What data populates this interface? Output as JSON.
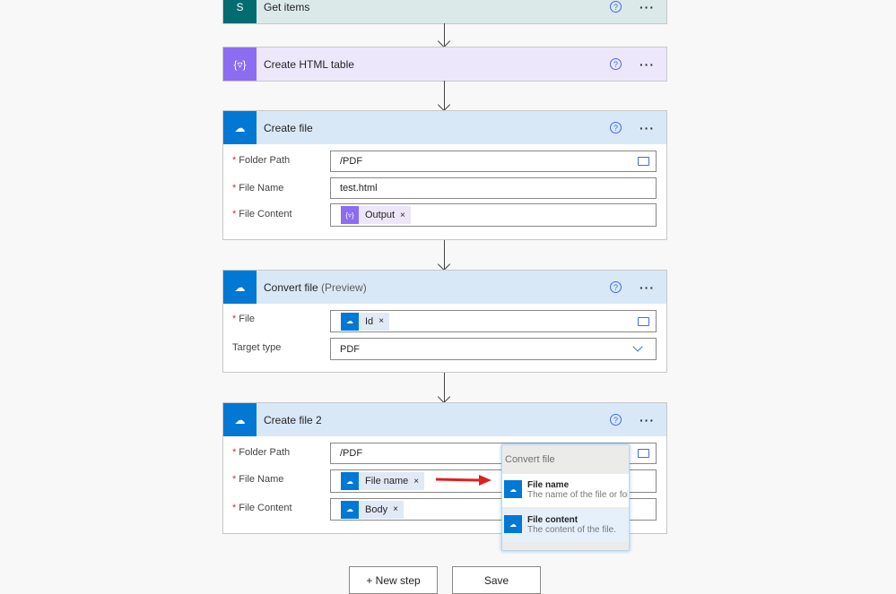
{
  "steps": [
    {
      "title": "Get items",
      "icon": "sharepoint-icon",
      "color": "#036c70",
      "header_bg": "#dbe9e9"
    },
    {
      "title": "Create HTML table",
      "icon": "data-operation-icon",
      "color": "#8c6cf0",
      "header_bg": "#ede7fc"
    },
    {
      "title": "Create file",
      "icon": "onedrive-icon",
      "color": "#0078d4",
      "header_bg": "#d9e8f6",
      "fields": [
        {
          "label": "Folder Path",
          "value": "/PDF"
        },
        {
          "label": "File Name",
          "value": "test.html"
        },
        {
          "label": "File Content",
          "token": "Output"
        }
      ]
    },
    {
      "title": "Convert file",
      "title_suffix": "(Preview)",
      "icon": "onedrive-icon",
      "color": "#0078d4",
      "header_bg": "#d9e8f6",
      "fields": [
        {
          "label": "File",
          "token": "Id"
        },
        {
          "label": "Target type",
          "value": "PDF"
        }
      ]
    },
    {
      "title": "Create file 2",
      "icon": "onedrive-icon",
      "color": "#0078d4",
      "header_bg": "#d9e8f6",
      "fields": [
        {
          "label": "Folder Path",
          "value": "/PDF"
        },
        {
          "label": "File Name",
          "token": "File name"
        },
        {
          "label": "File Content",
          "token": "Body"
        }
      ]
    }
  ],
  "required_mark": "*",
  "help_glyph": "?",
  "more_glyph": "···",
  "token_remove": "×",
  "dropdown": {
    "header": "Convert file",
    "items": [
      {
        "title": "File name",
        "desc": "The name of the file or folder."
      },
      {
        "title": "File content",
        "desc": "The content of the file."
      }
    ]
  },
  "buttons": {
    "new_step": "+ New step",
    "save": "Save"
  },
  "annotation_color": "#e02020"
}
